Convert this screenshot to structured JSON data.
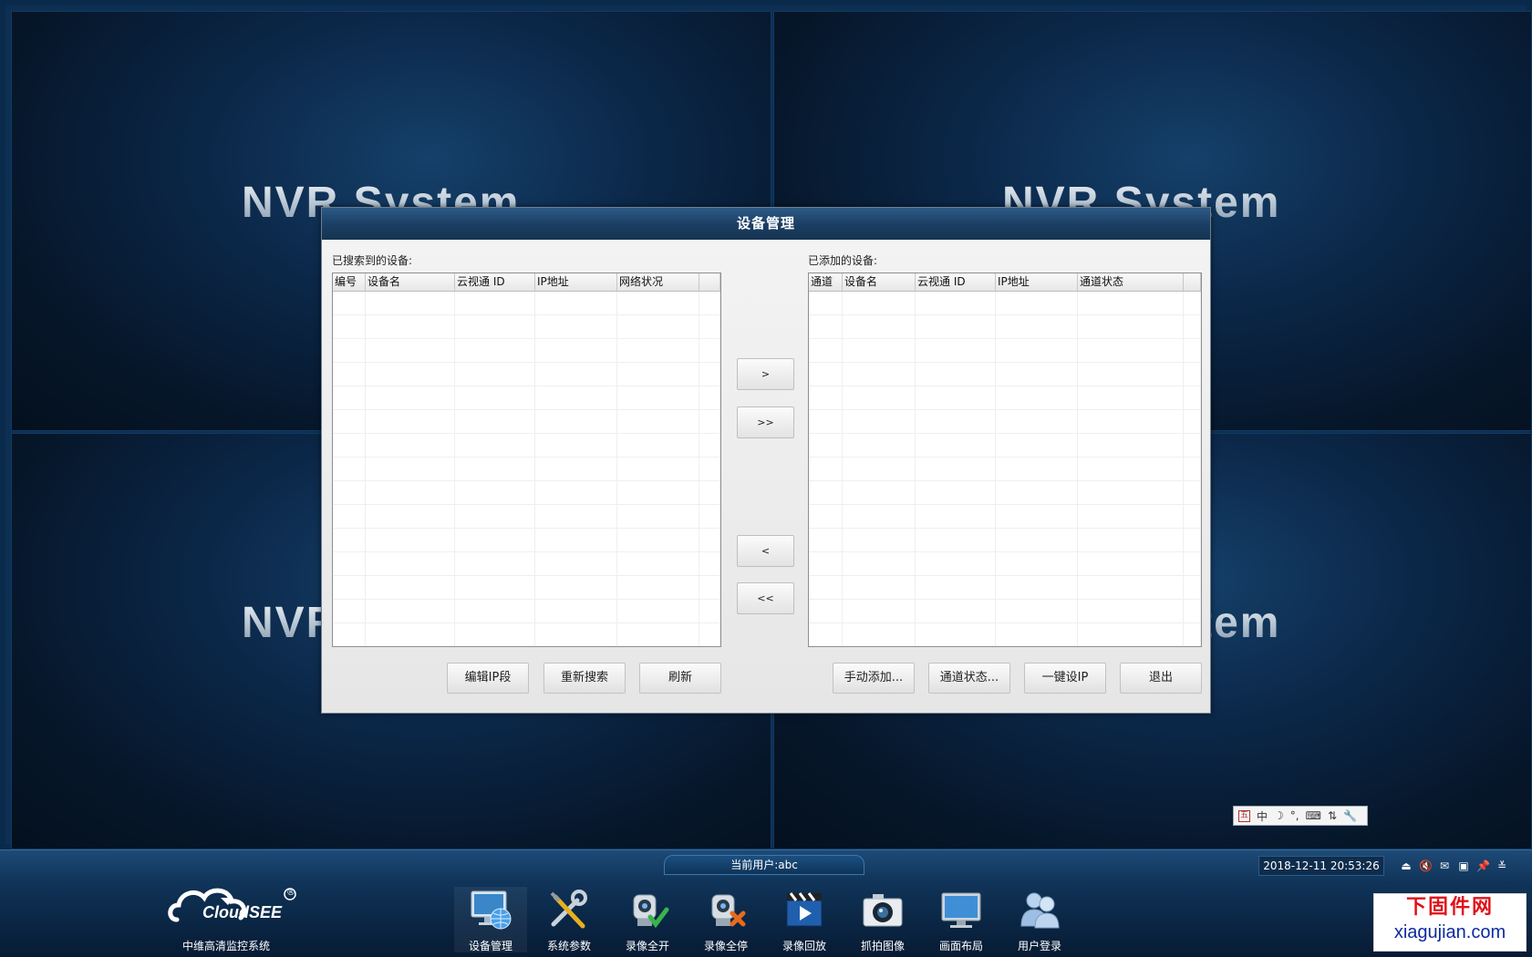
{
  "background": {
    "cells": [
      {
        "label": "NVR System"
      },
      {
        "label": "NVR System"
      },
      {
        "label": "NVR System"
      },
      {
        "label": "NVR System"
      }
    ]
  },
  "dialog": {
    "title": "设备管理",
    "left_panel": {
      "label": "已搜索到的设备:",
      "columns": [
        "编号",
        "设备名",
        "云视通 ID",
        "IP地址",
        "网络状况",
        ""
      ]
    },
    "right_panel": {
      "label": "已添加的设备:",
      "columns": [
        "通道",
        "设备名",
        "云视通 ID",
        "IP地址",
        "通道状态",
        ""
      ]
    },
    "move_buttons": {
      "add_one": ">",
      "add_all": ">>",
      "remove_one": "<",
      "remove_all": "<<"
    },
    "left_buttons": {
      "edit_ip": "编辑IP段",
      "research": "重新搜索",
      "refresh": "刷新"
    },
    "right_buttons": {
      "manual_add": "手动添加...",
      "channel_status": "通道状态...",
      "one_key_ip": "一键设IP",
      "exit": "退出"
    }
  },
  "ime": {
    "items": [
      "五",
      "中",
      "☽",
      "°,",
      "⌨",
      "⇅",
      "🔧"
    ]
  },
  "taskbar": {
    "current_user": "当前用户:abc",
    "logo_text": "CloudSEE",
    "logo_reg": "®",
    "app_name": "中维高清监控系统",
    "tools": [
      {
        "label": "设备管理",
        "icon": "monitor-globe-icon"
      },
      {
        "label": "系统参数",
        "icon": "tools-icon"
      },
      {
        "label": "录像全开",
        "icon": "camera-check-icon"
      },
      {
        "label": "录像全停",
        "icon": "camera-stop-icon"
      },
      {
        "label": "录像回放",
        "icon": "clapper-play-icon"
      },
      {
        "label": "抓拍图像",
        "icon": "photo-camera-icon"
      },
      {
        "label": "画面布局",
        "icon": "display-icon"
      },
      {
        "label": "用户登录",
        "icon": "users-icon"
      }
    ],
    "datetime": "2018-12-11 20:53:26",
    "tray": [
      "⏏",
      "🔇",
      "✉",
      "▣",
      "📌",
      "≚"
    ]
  },
  "watermark": {
    "cn": "下固件网",
    "url": "xiagujian.com"
  },
  "colors": {
    "taskbar_bg": "#0a2543",
    "dialog_title_bg": "#1a3d62",
    "watermark_red": "#e0121a",
    "watermark_blue": "#0c2a9e"
  }
}
